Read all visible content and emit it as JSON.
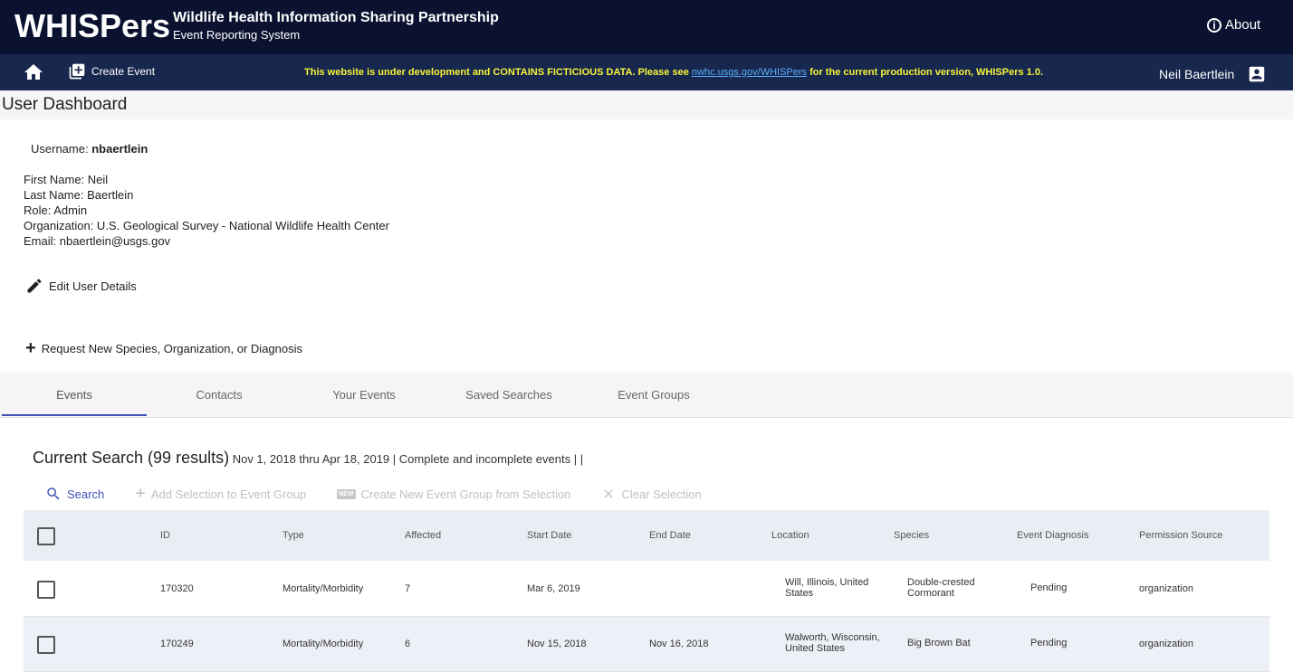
{
  "header": {
    "logo": "WHISPers",
    "title": "Wildlife Health Information Sharing Partnership",
    "subtitle": "Event Reporting System",
    "about_label": "About"
  },
  "nav": {
    "create_event_label": "Create Event",
    "notice_pre": "This website is under development and CONTAINS FICTICIOUS DATA. Please see ",
    "notice_link": "nwhc.usgs.gov/WHISPers",
    "notice_post": " for the current production version, WHISPers 1.0.",
    "user_name": "Neil Baertlein"
  },
  "page": {
    "title": "User Dashboard"
  },
  "user": {
    "username_label": "Username: ",
    "username": "nbaertlein",
    "first_name": "First Name: Neil",
    "last_name": "Last Name: Baertlein",
    "role": "Role: Admin",
    "organization": "Organization: U.S. Geological Survey - National Wildlife Health Center",
    "email": "Email: nbaertlein@usgs.gov"
  },
  "actions": {
    "edit_label": "Edit User Details",
    "request_label": "Request New Species, Organization, or Diagnosis"
  },
  "tabs": [
    {
      "label": "Events"
    },
    {
      "label": "Contacts"
    },
    {
      "label": "Your Events"
    },
    {
      "label": "Saved Searches"
    },
    {
      "label": "Event Groups"
    }
  ],
  "search": {
    "title": "Current Search (99 results)",
    "meta": " Nov 1, 2018 thru Apr 18, 2019  |  Complete and incomplete events |  |"
  },
  "toolbar": {
    "search_label": "Search",
    "add_label": "Add Selection to Event Group",
    "new_badge": "NEW",
    "create_label": "Create New Event Group from Selection",
    "clear_label": "Clear Selection"
  },
  "table": {
    "columns": [
      "ID",
      "Type",
      "Affected",
      "Start Date",
      "End Date",
      "Location",
      "Species",
      "Event Diagnosis",
      "Permission Source"
    ],
    "rows": [
      {
        "id": "170320",
        "type": "Mortality/Morbidity",
        "affected": "7",
        "start": "Mar 6, 2019",
        "end": "",
        "loc1": "Will, Illinois, United",
        "loc2": "States",
        "sp1": "Double-crested",
        "sp2": "Cormorant",
        "diagnosis": "Pending",
        "permission": "organization"
      },
      {
        "id": "170249",
        "type": "Mortality/Morbidity",
        "affected": "6",
        "start": "Nov 15, 2018",
        "end": "Nov 16, 2018",
        "loc1": "Walworth, Wisconsin,",
        "loc2": "United States",
        "sp1": "Big Brown Bat",
        "sp2": "",
        "diagnosis": "Pending",
        "permission": "organization"
      }
    ]
  }
}
